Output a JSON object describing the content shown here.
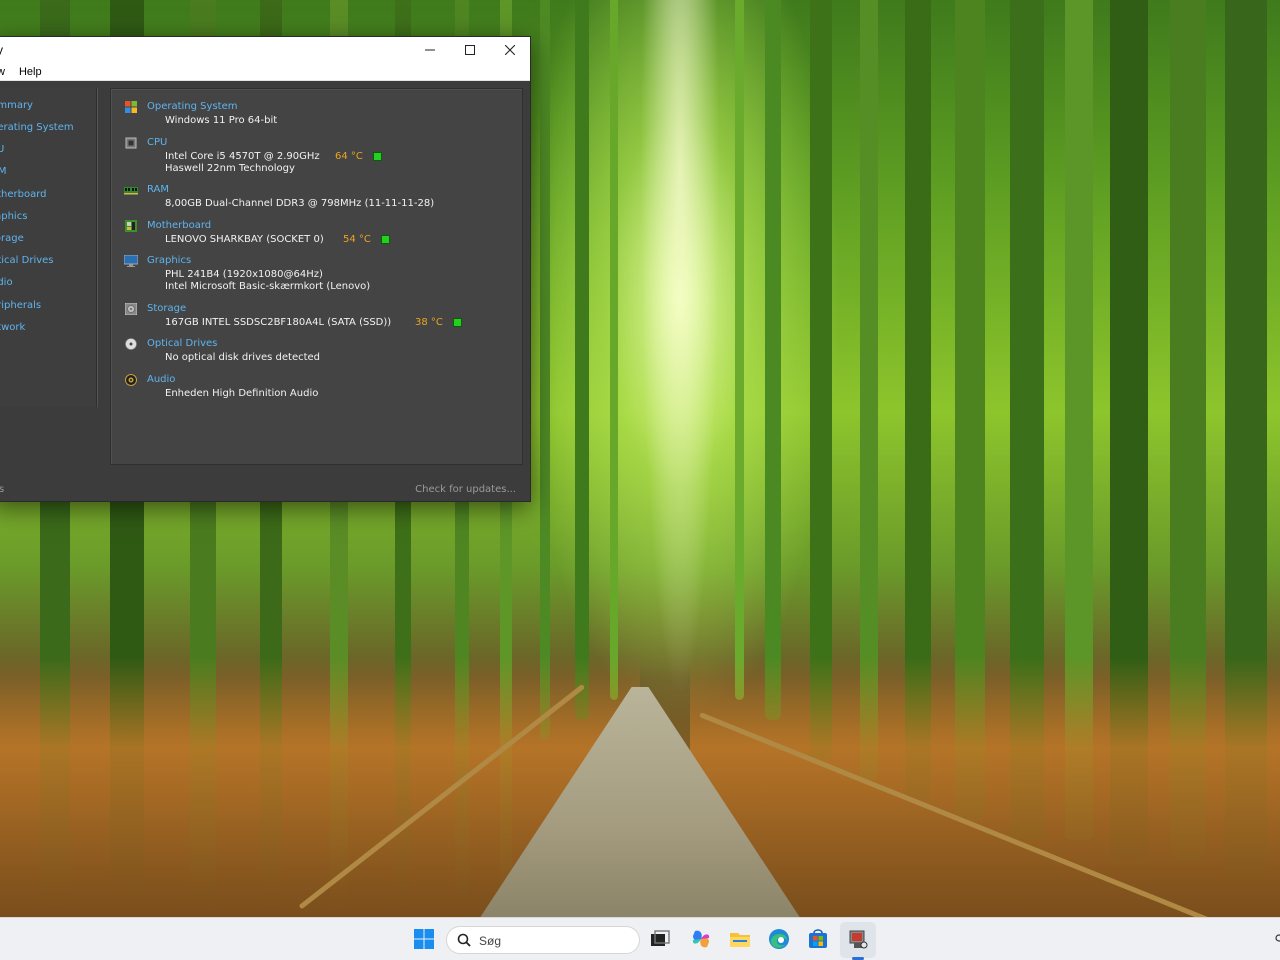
{
  "window": {
    "title": "y",
    "controls": {
      "minimize": "—",
      "maximize": "☐",
      "close": "✕"
    },
    "menu": [
      "w",
      "Help"
    ]
  },
  "sidebar": {
    "items": [
      {
        "label": "ummary"
      },
      {
        "label": "perating System"
      },
      {
        "label": "PU"
      },
      {
        "label": "AM"
      },
      {
        "label": "otherboard"
      },
      {
        "label": "raphics"
      },
      {
        "label": "torage"
      },
      {
        "label": "ptical Drives"
      },
      {
        "label": "udio"
      },
      {
        "label": "eripherals"
      },
      {
        "label": "etwork"
      }
    ]
  },
  "summary": {
    "os": {
      "title": "Operating System",
      "line1": "Windows 11 Pro 64-bit",
      "icon": "windows-logo-icon"
    },
    "cpu": {
      "title": "CPU",
      "line1": "Intel Core i5 4570T @ 2.90GHz",
      "temp": "64 °C",
      "line2": "Haswell 22nm Technology",
      "icon": "cpu-chip-icon"
    },
    "ram": {
      "title": "RAM",
      "line1": "8,00GB Dual-Channel DDR3 @ 798MHz (11-11-11-28)",
      "icon": "ram-module-icon"
    },
    "motherboard": {
      "title": "Motherboard",
      "line1": "LENOVO SHARKBAY (SOCKET 0)",
      "temp": "54 °C",
      "icon": "motherboard-icon"
    },
    "graphics": {
      "title": "Graphics",
      "line1": "PHL 241B4 (1920x1080@64Hz)",
      "line2": "Intel Microsoft Basic-skærmkort (Lenovo)",
      "icon": "monitor-icon"
    },
    "storage": {
      "title": "Storage",
      "line1": "167GB INTEL SSDSC2BF180A4L (SATA (SSD))",
      "temp": "38 °C",
      "icon": "hard-drive-icon"
    },
    "optical": {
      "title": "Optical Drives",
      "line1": "No optical disk drives detected",
      "icon": "optical-disc-icon"
    },
    "audio": {
      "title": "Audio",
      "line1": "Enheden High Definition Audio",
      "icon": "speaker-icon"
    }
  },
  "statusbar": {
    "left": "s",
    "update_link": "Check for updates..."
  },
  "taskbar": {
    "search_placeholder": "Søg",
    "icons": [
      "windows-start-icon",
      "search-icon",
      "task-view-icon",
      "copilot-icon",
      "file-explorer-icon",
      "edge-browser-icon",
      "microsoft-store-icon",
      "system-info-app-icon"
    ]
  },
  "colors": {
    "accent_link": "#5eb4ef",
    "temperature": "#e9a521",
    "temp_ok": "#22d120",
    "window_bg": "#3c3c3c"
  }
}
